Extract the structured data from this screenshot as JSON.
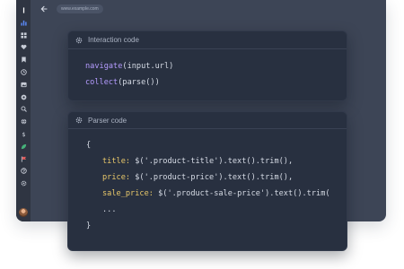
{
  "topbar": {
    "url": "www.example.com"
  },
  "interaction_card": {
    "title": "Interaction code",
    "lines": [
      {
        "fn": "navigate",
        "rest": "(input.url)"
      },
      {
        "fn": "collect",
        "rest": "(parse())"
      }
    ]
  },
  "parser_card": {
    "title": "Parser code",
    "open_brace": "{",
    "fields": [
      {
        "key": "title:",
        "value": "$('.product-title').text().trim(),"
      },
      {
        "key": "price:",
        "value": "$('.product-price').text().trim(),"
      },
      {
        "key": "sale_price:",
        "value": "$('.product-sale-price').text().trim("
      }
    ],
    "ellipsis": "...",
    "close_brace": "}"
  },
  "sidebar": {
    "icons": [
      "menu-icon",
      "bar-chart-icon",
      "grid-icon",
      "heart-icon",
      "bookmark-icon",
      "clock-icon",
      "image-icon",
      "settings-icon",
      "search-icon",
      "globe-icon",
      "dollar-icon",
      "leaf-icon",
      "flag-icon",
      "help-icon",
      "gear-icon"
    ]
  },
  "colors": {
    "window_bg": "#3d4556",
    "sidebar_bg": "#2f3542",
    "card_bg": "#283040",
    "function_color": "#b59cff",
    "key_color": "#e8c86a"
  }
}
